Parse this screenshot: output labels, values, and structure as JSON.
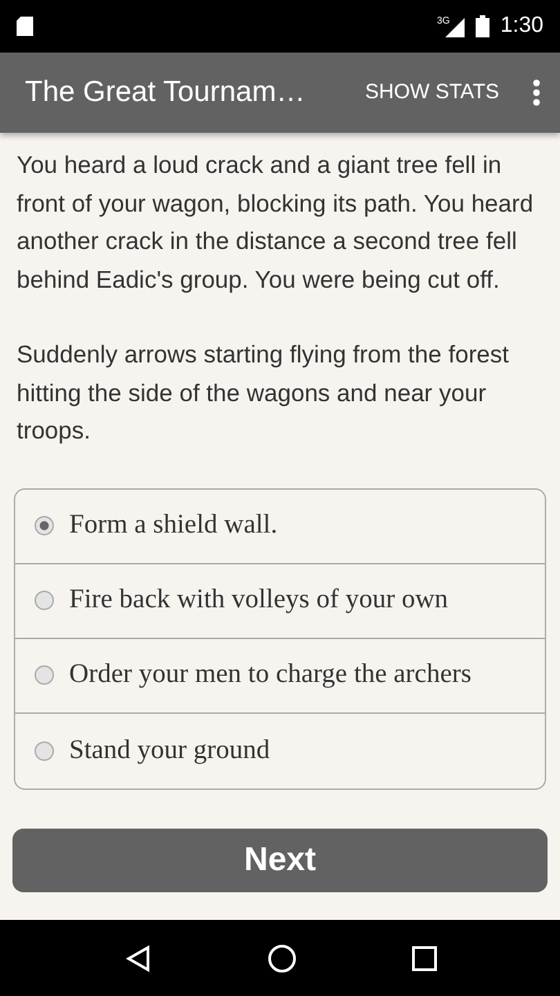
{
  "status_bar": {
    "time": "1:30",
    "network": "3G"
  },
  "app_bar": {
    "title": "The Great Tournam…",
    "action": "SHOW STATS"
  },
  "story": [
    "You heard a loud crack and a giant tree fell in front of your wagon, blocking its path. You heard another crack in the distance a second tree fell behind Eadic's group. You were being cut off.",
    "Suddenly arrows starting flying from the forest hitting the side of the wagons and near your troops."
  ],
  "choices": [
    {
      "label": "Form a shield wall.",
      "selected": true
    },
    {
      "label": "Fire back with volleys of your own",
      "selected": false
    },
    {
      "label": "Order your men to charge the archers",
      "selected": false
    },
    {
      "label": "Stand your ground",
      "selected": false
    }
  ],
  "next_button": "Next"
}
